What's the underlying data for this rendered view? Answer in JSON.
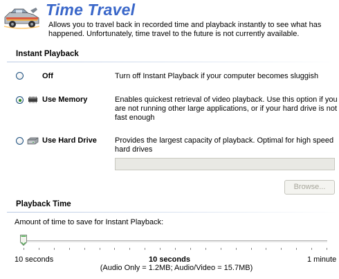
{
  "header": {
    "title": "Time Travel",
    "description": "Allows you to travel back in recorded time and playback instantly to see what has happened.  Unfortunately, time travel to the future is not currently available."
  },
  "instant_playback": {
    "section_title": "Instant Playback",
    "selected": "use_memory",
    "options": [
      {
        "id": "off",
        "label": "Off",
        "description": "Turn off Instant Playback if your computer becomes sluggish",
        "icon": ""
      },
      {
        "id": "use_memory",
        "label": "Use Memory",
        "description": "Enables quickest retrieval of video playback.  Use this option if you are not running other large applications, or if your hard drive is not fast enough",
        "icon": "memory-chip-icon"
      },
      {
        "id": "use_hard_drive",
        "label": "Use Hard Drive",
        "description": "Provides the largest capacity of playback.  Optimal for high speed hard drives",
        "icon": "hard-drive-icon"
      }
    ],
    "hard_drive_path": {
      "value": "",
      "placeholder": ""
    },
    "browse_label": "Browse..."
  },
  "playback_time": {
    "section_title": "Playback Time",
    "prompt": "Amount of time to save for Instant Playback:",
    "slider": {
      "min_label": "10 seconds",
      "max_label": "1 minute",
      "value_fraction": 0.0,
      "tick_count": 21
    },
    "current_value": "10 seconds",
    "size_info": "(Audio Only = 1.2MB; Audio/Video = 15.7MB)"
  },
  "colors": {
    "title": "#3a67c9",
    "section_rule": "#b9c9e3",
    "disabled_text": "#a7a69b"
  }
}
